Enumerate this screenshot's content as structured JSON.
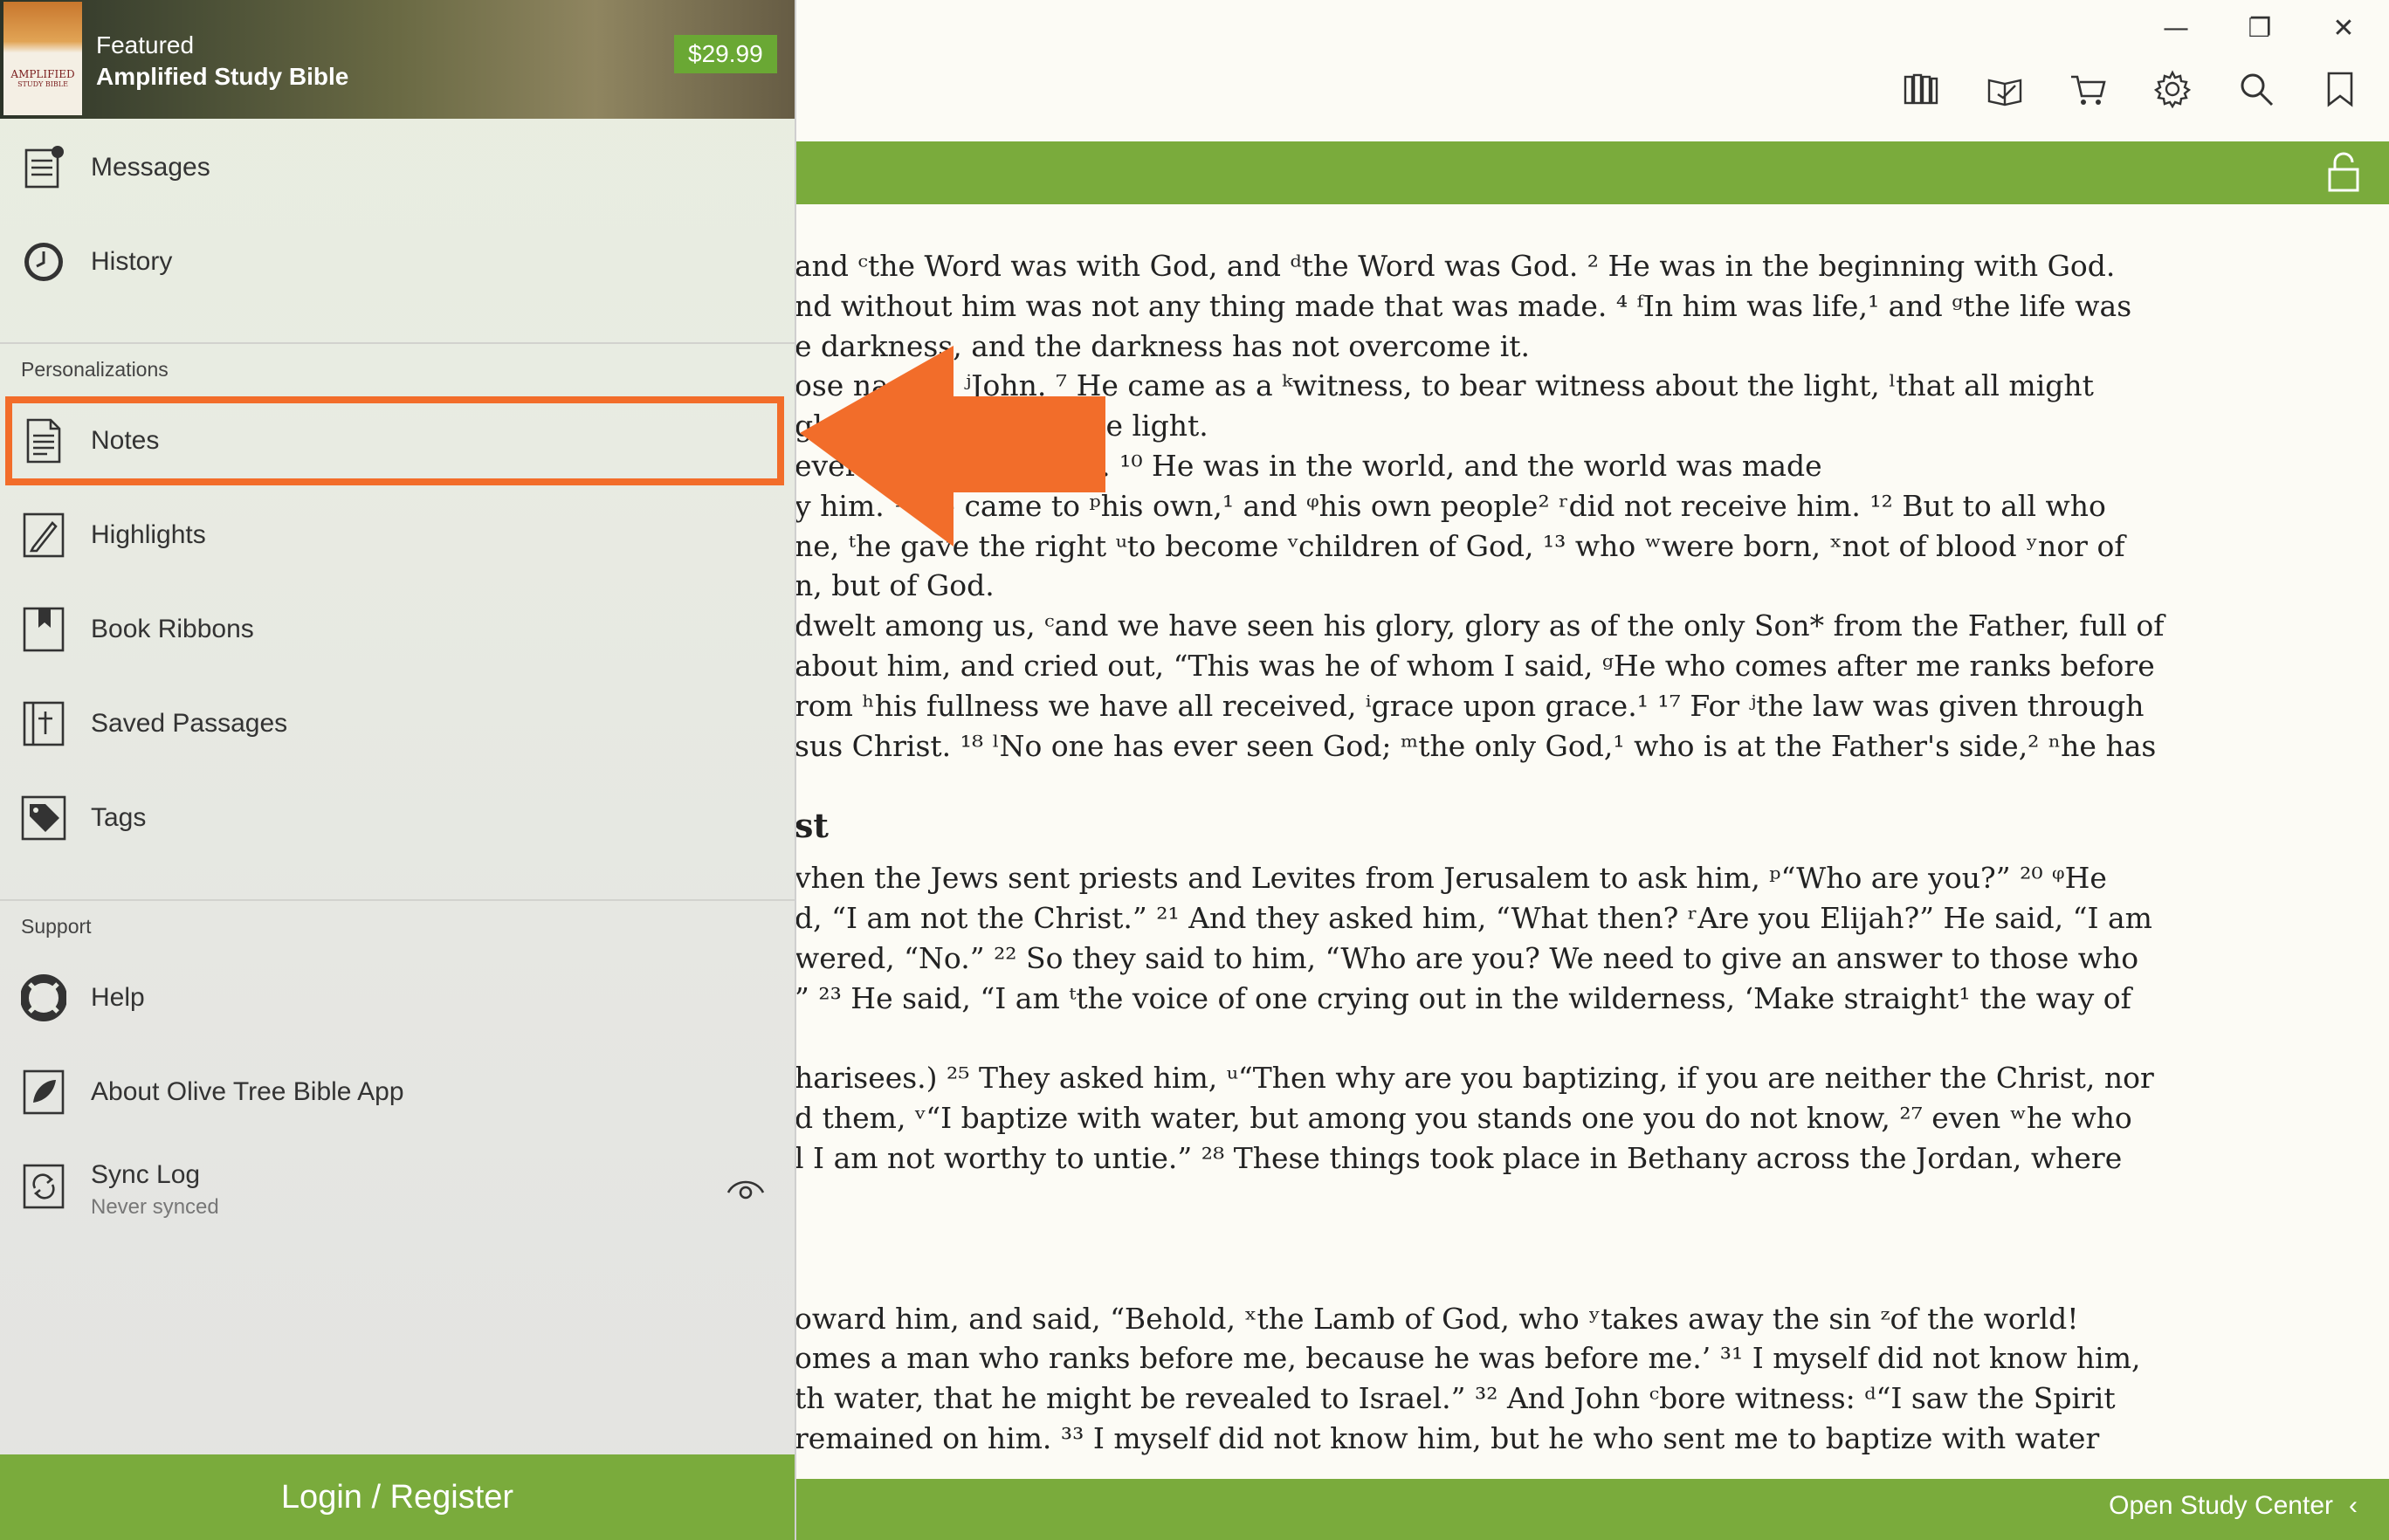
{
  "featured": {
    "kicker": "Featured",
    "title": "Amplified Study Bible",
    "price": "$29.99",
    "cover_text": "AMPLIFIED",
    "cover_subtext": "STUDY BIBLE"
  },
  "menu": {
    "top": [
      {
        "label": "Messages",
        "icon": "messages-icon"
      },
      {
        "label": "History",
        "icon": "clock-icon"
      }
    ],
    "personalizations_title": "Personalizations",
    "personalizations": [
      {
        "label": "Notes",
        "icon": "notes-icon"
      },
      {
        "label": "Highlights",
        "icon": "highlight-pen-icon"
      },
      {
        "label": "Book Ribbons",
        "icon": "ribbon-icon"
      },
      {
        "label": "Saved Passages",
        "icon": "saved-passage-icon"
      },
      {
        "label": "Tags",
        "icon": "tag-icon"
      }
    ],
    "support_title": "Support",
    "support": [
      {
        "label": "Help",
        "icon": "lifebuoy-icon"
      },
      {
        "label": "About Olive Tree Bible App",
        "icon": "olive-leaf-icon"
      },
      {
        "label": "Sync Log",
        "sub": "Never synced",
        "icon": "sync-icon"
      }
    ]
  },
  "login_label": "Login / Register",
  "open_study_center": "Open Study Center",
  "open_study_chevron": "‹",
  "window_controls": {
    "minimize": "—",
    "restore": "❐",
    "close": "✕"
  },
  "toolbar_icons": [
    "library-icon",
    "reading-plan-icon",
    "store-cart-icon",
    "settings-gear-icon",
    "search-icon",
    "bookmark-icon"
  ],
  "colors": {
    "accent_green": "#7aab3c",
    "highlight_orange": "#f26d2a",
    "price_green": "#6aa834"
  },
  "verses": [
    "and ᶜthe Word was with God, and ᵈthe Word was God. ² He was in the beginning with God.",
    "nd without him was not any thing made that was made. ⁴ ᶠIn him was life,¹ and ᵍthe life was",
    "e darkness, and the darkness has not overcome it.",
    "ose na        was ʲJohn. ⁷ He came as a ᵏwitness, to bear witness about the light, ˡthat all might",
    "gh                  r witness about the light.",
    "ever                g into the world. ¹⁰ He was in the world, and the world was made",
    "y him. ¹¹ ʰe came to ᵖhis own,¹ and ᵠhis own people² ʳdid not receive him. ¹² But to all who",
    "ne, ᵗhe gave the right ᵘto become ᵛchildren of God, ¹³ who ʷwere born, ˣnot of blood ʸnor of",
    "n, but of God.",
    "dwelt among us, ᶜand we have seen his glory, glory as of the only Son* from the Father, full of",
    "about him, and cried out, “This was he of whom I said, ᵍHe who comes after me ranks before",
    "rom ʰhis fullness we have all received, ⁱgrace upon grace.¹ ¹⁷ For ʲthe law was given through",
    "sus Christ. ¹⁸ ˡNo one has ever seen God; ᵐthe only God,¹ who is at the Father's side,² ⁿhe has"
  ],
  "heading_fragment": "st",
  "verses2": [
    "vhen the Jews sent priests and Levites from Jerusalem to ask him, ᵖ“Who are you?” ²⁰ ᵠHe",
    "d, “I am not the Christ.” ²¹ And they asked him, “What then? ʳAre you Elijah?” He said, “I am",
    "wered, “No.” ²² So they said to him, “Who are you? We need to give an answer to those who",
    "” ²³ He said, “I am ᵗthe voice of one crying out in the wilderness, ‘Make straight¹ the way of"
  ],
  "verses3": [
    "harisees.) ²⁵ They asked him, ᵘ“Then why are you baptizing, if you are neither the Christ, nor",
    "d them, ᵛ“I baptize with water, but among you stands one you do not know, ²⁷ even ʷhe who",
    "l I am not worthy to untie.” ²⁸ These things took place in Bethany across the Jordan, where"
  ],
  "verses4": [
    "oward him, and said, “Behold, ˣthe Lamb of God, who ʸtakes away the sin ᶻof the world!",
    "omes a man who ranks before me, because he was before me.’ ³¹ I myself did not know him,",
    "th water, that he might be revealed to Israel.” ³² And John ᶜbore witness: ᵈ“I saw the Spirit",
    "remained on him. ³³ I myself did not know him, but he who sent me to baptize with water"
  ]
}
